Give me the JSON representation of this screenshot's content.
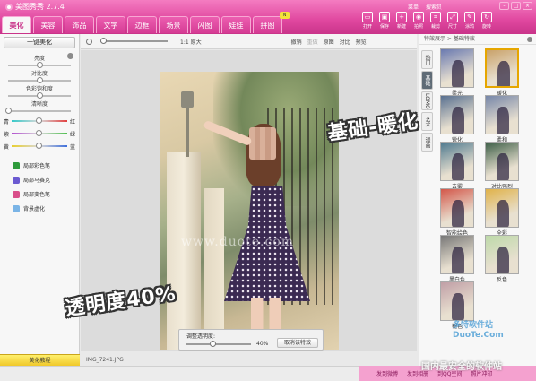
{
  "app": {
    "title": "美图秀秀 2.7.4"
  },
  "main_tabs": [
    "美化",
    "美容",
    "饰品",
    "文字",
    "边框",
    "场景",
    "闪图",
    "娃娃",
    "拼图"
  ],
  "top_links": [
    "菜单",
    "搜索贝"
  ],
  "window_controls": [
    "-",
    "□",
    "×"
  ],
  "toolbar_tools": [
    {
      "label": "打开",
      "icon": "folder-icon"
    },
    {
      "label": "保存",
      "icon": "save-icon"
    },
    {
      "label": "新建",
      "icon": "new-icon"
    },
    {
      "label": "拍照",
      "icon": "camera-icon"
    },
    {
      "label": "裁剪",
      "icon": "crop-icon"
    },
    {
      "label": "尺寸",
      "icon": "resize-icon"
    },
    {
      "label": "涂鸦",
      "icon": "brush-icon"
    },
    {
      "label": "旋转",
      "icon": "rotate-icon"
    }
  ],
  "left_panel": {
    "one_key_button": "一键美化",
    "adjustments": [
      {
        "label": "亮度",
        "value": 0.5
      },
      {
        "label": "对比度",
        "value": 0.5
      },
      {
        "label": "色彩饱和度",
        "value": 0.5
      },
      {
        "label": "清晰度",
        "value": 0.0
      }
    ],
    "color_balance": [
      {
        "left": "青",
        "right": "红",
        "gradient": "linear-gradient(90deg,#36c9c9,#d9d9d9,#e24040)"
      },
      {
        "left": "紫",
        "right": "绿",
        "gradient": "linear-gradient(90deg,#b24fcf,#d9d9d9,#4fbf4f)"
      },
      {
        "left": "黄",
        "right": "蓝",
        "gradient": "linear-gradient(90deg,#e8cf2f,#d9d9d9,#3f6fdb)"
      }
    ],
    "brushes": [
      {
        "label": "局部彩色笔",
        "color": "#2e9b3c"
      },
      {
        "label": "局部马赛克",
        "color": "#6b5ad1"
      },
      {
        "label": "局部变色笔",
        "color": "#d94f8a"
      },
      {
        "label": "背景虚化",
        "color": "#7ab4e6"
      }
    ],
    "tutorial_button": "美化教程"
  },
  "canvas_toolbar": {
    "zoom_label": "1:1 原大",
    "undo": "撤销",
    "redo": "重做",
    "original": "原图",
    "compare": "对比",
    "preview": "预览"
  },
  "photo_watermark": "www.duote.com",
  "opacity_panel": {
    "label": "调整透明度:",
    "value": 0.4,
    "percent_text": "40%",
    "cancel_button": "取消该特效"
  },
  "status": {
    "filename": "IMG_7241.JPG"
  },
  "right_panel": {
    "breadcrumb": "特效展示 > 基础特效",
    "vertical_tabs": [
      "热门",
      "基础",
      "LOMO",
      "艺术",
      "漫画"
    ],
    "active_tab": 1,
    "effects": [
      {
        "label": "柔光",
        "tint": "#6a7ab0"
      },
      {
        "label": "暖化",
        "tint": "#c9a26a",
        "selected": true
      },
      {
        "label": "锐化",
        "tint": "#587090"
      },
      {
        "label": "柔和",
        "tint": "#7686a8"
      },
      {
        "label": "去雾",
        "tint": "#4f7a8f"
      },
      {
        "label": "对比强烈",
        "tint": "#3e5f48"
      },
      {
        "label": "智能绘色",
        "tint": "#d3574a"
      },
      {
        "label": "全彩",
        "tint": "#e0b24a"
      },
      {
        "label": "黑白色",
        "tint": "#777777"
      },
      {
        "label": "反色",
        "tint": "#bdd9a9"
      },
      {
        "label": "褪色",
        "tint": "#c09fa6"
      }
    ]
  },
  "annotations": {
    "effect_note": "基础-暖化",
    "opacity_note": "透明度40%"
  },
  "bottom_bar": [
    "发到微博",
    "发到相册",
    "到QQ空间",
    "照片冲印"
  ],
  "site_watermark": {
    "logo": "多特软件站 DuoTe.Com",
    "tagline": "国内最安全的软件站"
  }
}
